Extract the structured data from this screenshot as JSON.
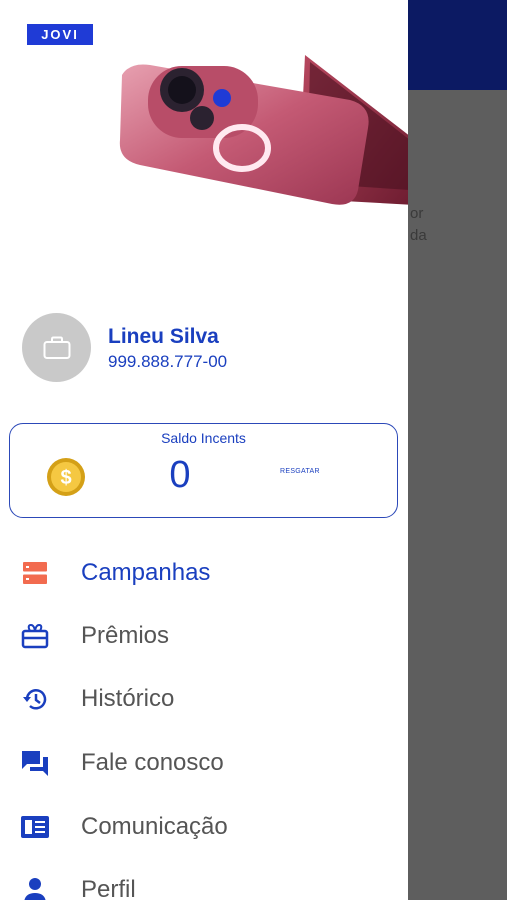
{
  "background": {
    "text_line1": "or",
    "text_line2": "da",
    "header_color": "#0c1a63"
  },
  "drawer": {
    "brand_badge": "JOVI",
    "user": {
      "name": "Lineu Silva",
      "document": "999.888.777-00",
      "avatar_icon": "briefcase-icon"
    },
    "balance": {
      "title": "Saldo Incents",
      "value": "0",
      "redeem_label": "RESGATAR",
      "coin_icon": "dollar-coin-icon"
    },
    "menu": [
      {
        "label": "Campanhas",
        "icon": "campaigns-icon",
        "active": true
      },
      {
        "label": "Prêmios",
        "icon": "gift-icon",
        "active": false
      },
      {
        "label": "Histórico",
        "icon": "history-icon",
        "active": false
      },
      {
        "label": "Fale conosco",
        "icon": "chat-icon",
        "active": false
      },
      {
        "label": "Comunicação",
        "icon": "newsletter-icon",
        "active": false
      },
      {
        "label": "Perfil",
        "icon": "person-icon",
        "active": false
      }
    ]
  },
  "colors": {
    "accent": "#1a3fbf",
    "brand": "#1f3bd6",
    "campaign_icon": "#f26b4f",
    "menu_text": "#555555"
  }
}
